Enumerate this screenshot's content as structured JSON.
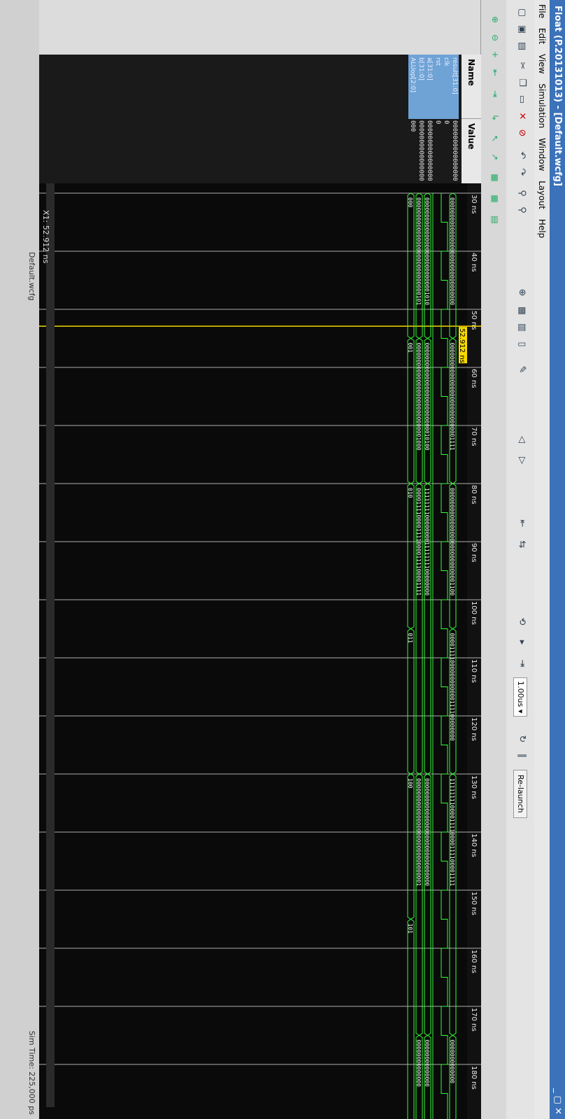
{
  "window": {
    "title": "Float (P.20131013) - [Default.wcfg]",
    "controls": "_ ▢ ✕"
  },
  "menu": {
    "items": [
      "File",
      "Edit",
      "View",
      "Simulation",
      "Window",
      "Layout",
      "Help"
    ]
  },
  "toolbar": {
    "zoom_value": "1.00us",
    "relaunch_label": "Re-launch"
  },
  "columns": {
    "name": "Name",
    "value": "Value"
  },
  "signals": [
    {
      "name": "result[31:0]",
      "value": "0000000000000000"
    },
    {
      "name": "clk",
      "value": "0"
    },
    {
      "name": "rst",
      "value": "0"
    },
    {
      "name": "a[31:0]",
      "value": "0000000000000000"
    },
    {
      "name": "b[31:0]",
      "value": "0000000000000000"
    },
    {
      "name": "ALUop[2:0]",
      "value": "000"
    }
  ],
  "timeline": {
    "ticks": [
      "30 ns",
      "40 ns",
      "50 ns",
      "60 ns",
      "70 ns",
      "80 ns",
      "90 ns",
      "100 ns",
      "110 ns",
      "120 ns",
      "130 ns",
      "140 ns",
      "150 ns",
      "160 ns",
      "170 ns",
      "180 ns"
    ],
    "cursor_label": "52.912 ns",
    "x1_label": "X1: 52.912 ns"
  },
  "wave_values": {
    "result": [
      "00000000000000000000000000000000",
      "00000000000000000000000000001111",
      "00000000000000000000000000001100",
      "00001111000000000000111100000000",
      "11111111000011110000111100001111",
      "0000000000000"
    ],
    "a": [
      "00000000000000000000000000001010",
      "00000000000000000000000000010100",
      "11111111000000001111111100000000",
      "00000000000000000000000000000000",
      "00000000000000"
    ],
    "b": [
      "00000000000000000000000000000101",
      "00000000000000000000000000001000",
      "00001111000011110000111100001111",
      "00000000000000000000000000000001",
      "00000000000000"
    ],
    "aluop": [
      "000",
      "001",
      "010",
      "011",
      "100",
      "101"
    ]
  },
  "status": {
    "tab": "Default.wcfg",
    "sim_time": "Sim Time: 225,000 ps"
  },
  "colors": {
    "wave": "#33ff33",
    "cursor": "#f5d800",
    "bg": "#0a0a0a"
  }
}
